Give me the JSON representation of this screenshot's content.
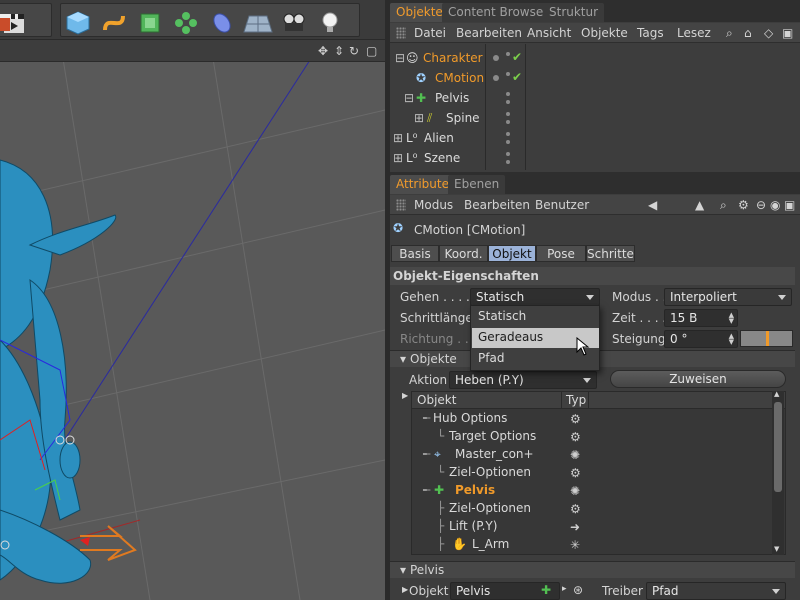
{
  "toolbar": {
    "buttons": [
      "clapper-icon",
      "cube-icon",
      "spline-icon",
      "nurbs-icon",
      "array-icon",
      "deformer-icon",
      "floor-icon",
      "camera-icon",
      "light-icon"
    ]
  },
  "object_manager": {
    "tabs": [
      "Objekte",
      "Content Browser",
      "Struktur"
    ],
    "menu": [
      "Datei",
      "Bearbeiten",
      "Ansicht",
      "Objekte",
      "Tags",
      "Lesez"
    ],
    "rows": [
      {
        "name": "Charakter"
      },
      {
        "name": "CMotion"
      },
      {
        "name": "Pelvis"
      },
      {
        "name": "Spine"
      },
      {
        "name": "Alien"
      },
      {
        "name": "Szene"
      }
    ]
  },
  "attribute_manager": {
    "tabs": [
      "Attribute",
      "Ebenen"
    ],
    "menu": [
      "Modus",
      "Bearbeiten",
      "Benutzer"
    ],
    "object_title": "CMotion [CMotion]",
    "segments": [
      "Basis",
      "Koord.",
      "Objekt",
      "Pose",
      "Schritte"
    ],
    "section_title": "Objekt-Eigenschaften",
    "gehen_label": "Gehen . . . . .",
    "gehen_value": "Statisch",
    "schrittlaenge_label": "Schrittlänge",
    "richtung_label": "Richtung . . .",
    "modus_label": "Modus . .",
    "modus_value": "Interpoliert",
    "zeit_label": "Zeit . . . .",
    "zeit_value": "15 B",
    "steigung_label": "Steigung",
    "steigung_value": "0 °",
    "dropdown_options": [
      "Statisch",
      "Geradeaus",
      "Pfad"
    ],
    "objekte_section": "Objekte",
    "aktion_label": "Aktion",
    "aktion_value": "Heben (P.Y)",
    "zuweisen_label": "Zuweisen",
    "tree_headers": [
      "Objekt",
      "Typ"
    ],
    "tree_rows": [
      {
        "name": "Hub Options"
      },
      {
        "name": "Target Options"
      },
      {
        "name": "Master_con+"
      },
      {
        "name": "Ziel-Optionen"
      },
      {
        "name": "Pelvis"
      },
      {
        "name": "Ziel-Optionen"
      },
      {
        "name": "Lift (P.Y)"
      },
      {
        "name": "L_Arm"
      }
    ],
    "pelvis_section": "Pelvis",
    "objekt_label": "Objekt",
    "objekt_value": "Pelvis",
    "treiber_label": "Treiber",
    "treiber_value": "Pfad"
  }
}
